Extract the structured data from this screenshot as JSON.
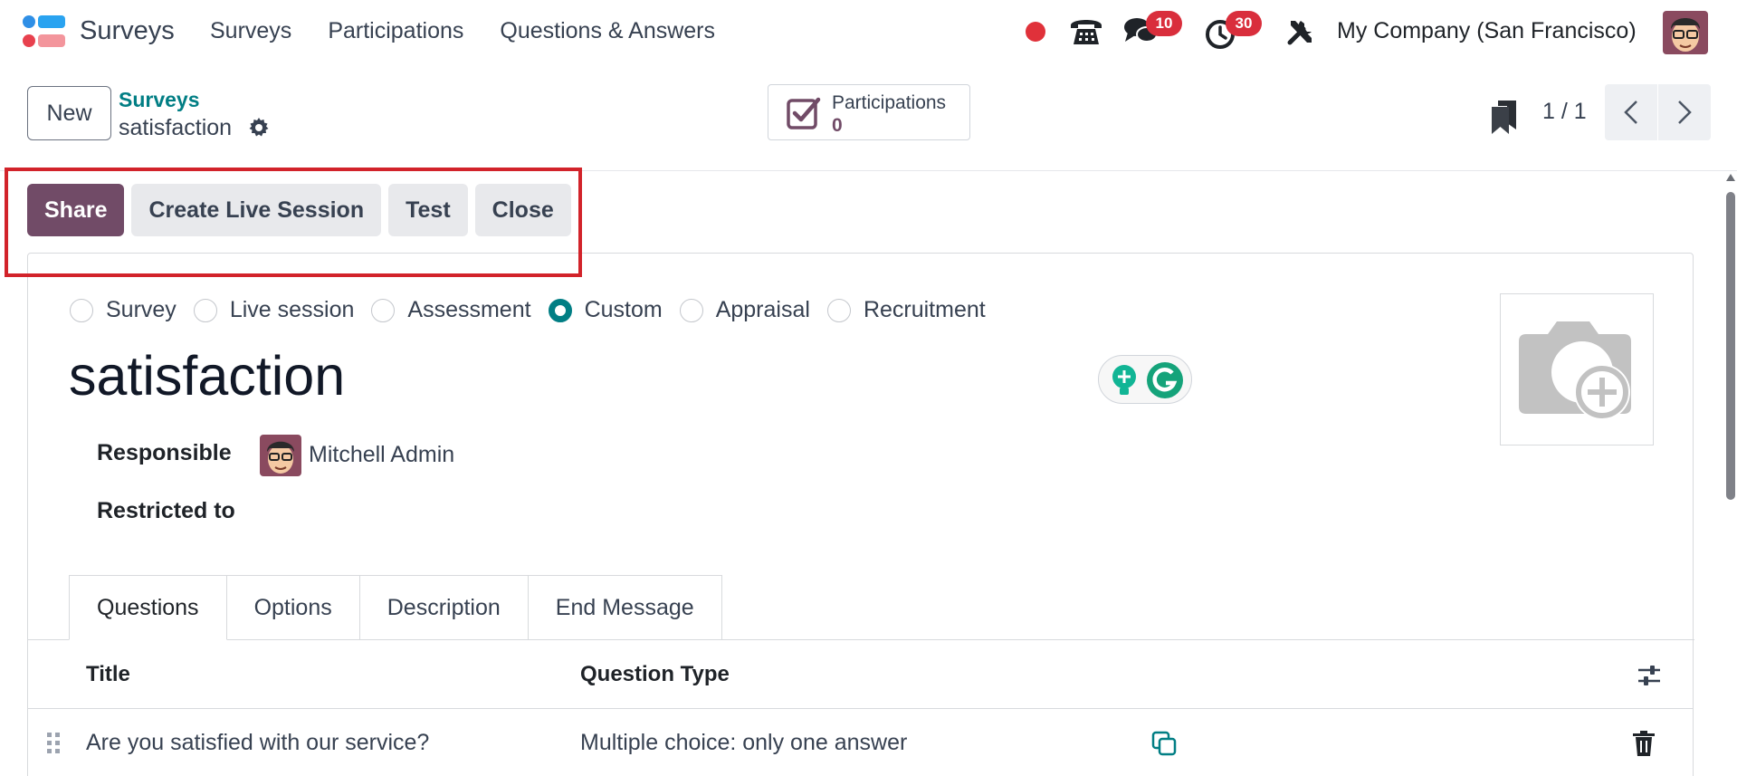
{
  "navbar": {
    "app_name": "Surveys",
    "menu": [
      "Surveys",
      "Participations",
      "Questions & Answers"
    ],
    "messages_badge": "10",
    "activities_badge": "30",
    "company": "My Company (San Francisco)"
  },
  "control": {
    "new_label": "New",
    "breadcrumb": "Surveys",
    "record_name": "satisfaction",
    "smart_button": {
      "label": "Participations",
      "value": "0"
    },
    "pager": "1 / 1"
  },
  "statusbar": {
    "share": "Share",
    "live_session": "Create Live Session",
    "test": "Test",
    "close": "Close"
  },
  "form": {
    "survey_types": [
      {
        "label": "Survey",
        "selected": false
      },
      {
        "label": "Live session",
        "selected": false
      },
      {
        "label": "Assessment",
        "selected": false
      },
      {
        "label": "Custom",
        "selected": true
      },
      {
        "label": "Appraisal",
        "selected": false
      },
      {
        "label": "Recruitment",
        "selected": false
      }
    ],
    "title": "satisfaction",
    "responsible_label": "Responsible",
    "responsible_value": "Mitchell Admin",
    "restricted_label": "Restricted to"
  },
  "tabs": [
    "Questions",
    "Options",
    "Description",
    "End Message"
  ],
  "table": {
    "headers": {
      "title": "Title",
      "type": "Question Type"
    },
    "rows": [
      {
        "title": "Are you satisfied with our service?",
        "type": "Multiple choice: only one answer"
      }
    ]
  },
  "colors": {
    "primary": "#714b67",
    "teal": "#017e84",
    "badge": "#d92e3c",
    "highlight": "#d2232a"
  }
}
